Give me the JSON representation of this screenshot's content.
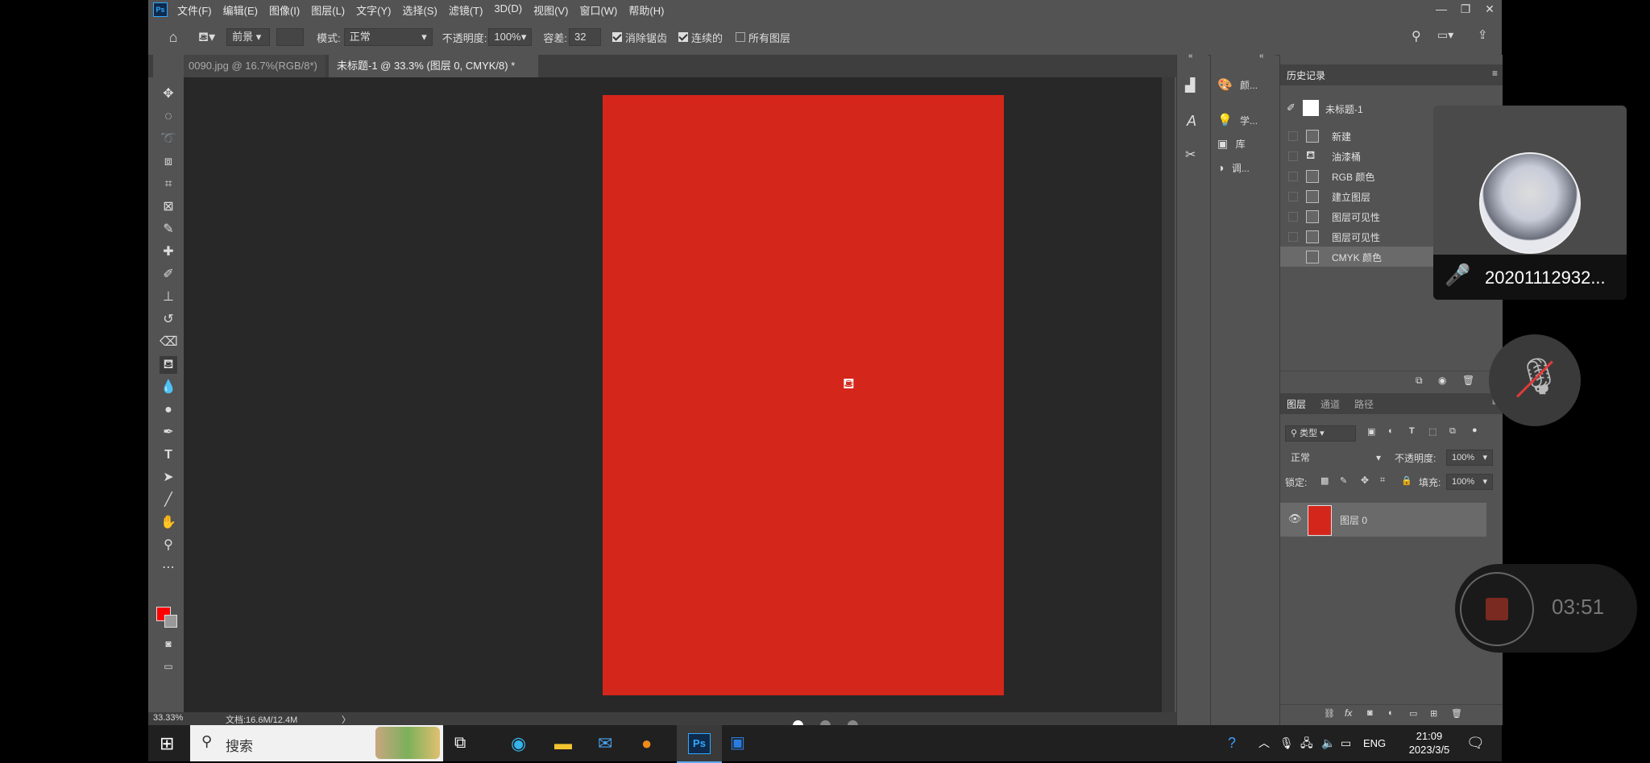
{
  "app": {
    "logo": "Ps",
    "menu": [
      "文件(F)",
      "编辑(E)",
      "图像(I)",
      "图层(L)",
      "文字(Y)",
      "选择(S)",
      "滤镜(T)",
      "3D(D)",
      "视图(V)",
      "窗口(W)",
      "帮助(H)"
    ],
    "window_buttons": [
      "—",
      "❐",
      "✕"
    ]
  },
  "options": {
    "fill_source": "前景",
    "mode_label": "模式:",
    "mode_value": "正常",
    "opacity_label": "不透明度:",
    "opacity_value": "100%",
    "tolerance_label": "容差:",
    "tolerance_value": "32",
    "antialias_label": "消除锯齿",
    "contiguous_label": "连续的",
    "all_layers_label": "所有图层"
  },
  "tabs": [
    {
      "label": "0090.jpg @ 16.7%(RGB/8*)"
    },
    {
      "label": "未标题-1 @ 33.3% (图层 0, CMYK/8) *"
    }
  ],
  "status": {
    "zoom": "33.33%",
    "doc": "文档:16.6M/12.4M",
    "arrow": "〉"
  },
  "dock": {
    "items": [
      "颜...",
      "学...",
      "库",
      "调..."
    ]
  },
  "history": {
    "tab": "历史记录",
    "snapshot": "未标题-1",
    "steps": [
      "新建",
      "油漆桶",
      "RGB 颜色",
      "建立图层",
      "图层可见性",
      "图层可见性",
      "CMYK 颜色"
    ]
  },
  "layers": {
    "tabs": [
      "图层",
      "通道",
      "路径"
    ],
    "filter_kind": "类型",
    "blend_mode": "正常",
    "opacity_label": "不透明度:",
    "opacity_value": "100%",
    "lock_label": "锁定:",
    "fill_label": "填充:",
    "fill_value": "100%",
    "layer_name": "图层 0"
  },
  "taskbar": {
    "search": "搜索",
    "lang": "ENG",
    "time": "21:09",
    "date": "2023/3/5"
  },
  "overlay": {
    "caller": "20201112932...",
    "timer": "03:51"
  },
  "colors": {
    "fill": "#d5261c",
    "panel": "#535353",
    "workspace": "#282828"
  }
}
